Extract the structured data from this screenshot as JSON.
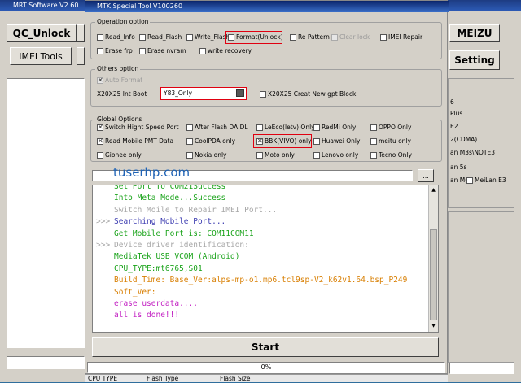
{
  "bg_window": {
    "title": "MRT Software V2.60",
    "qc_unlock": "QC_Unlock",
    "imei_tools": "IMEI Tools",
    "meizu": "MEIZU",
    "setting": "Setting",
    "right_items": [
      "6",
      "Plus",
      "E2",
      "2(CDMA)",
      "an M3s\\NOTE3",
      "an 5s",
      "an M6",
      "MeiLan E3"
    ],
    "table_headers": [
      "CPU TYPE",
      "Flash Type",
      "Flash Size"
    ]
  },
  "dialog": {
    "title": "MTK Special Tool V100260",
    "operation": {
      "legend": "Operation option",
      "items": [
        "Read_Info",
        "Read_Flash",
        "Write_Flash",
        "Format(Unlock)",
        "Re Pattern l",
        "Clear lock",
        "IMEI Repair",
        "Erase frp",
        "Erase nvram",
        "write recovery"
      ]
    },
    "others": {
      "legend": "Others option",
      "auto_format": "Auto Format",
      "int_boot_label": "X20X25 Int Boot",
      "int_boot_value": "Y83_Only",
      "creat_gpt": "X20X25 Creat New gpt Block"
    },
    "global": {
      "legend": "Global Options",
      "items": [
        "Switch Hight Speed Port",
        "After Flash DA DL",
        "LeEco(letv) Only",
        "RedMi Only",
        "OPPO Only",
        "Read Mobile PMT Data",
        "CoolPDA only",
        "BBK(VIVO) only",
        "Huawei Only",
        "meitu only",
        "Gionee only",
        "Nokia only",
        "Moto only",
        "Lenovo only",
        "Tecno Only"
      ]
    },
    "watermark": "tuserhp.com",
    "browse_label": "...",
    "log_lines": [
      {
        "prefix": "",
        "text": "Set Port To COM21Success",
        "color": "#1aa31a"
      },
      {
        "prefix": "",
        "text": "Into Meta Mode...Success",
        "color": "#1aa31a"
      },
      {
        "prefix": "",
        "text": "Switch Moile to Repair IMEI Port...",
        "color": "#a8a8a8"
      },
      {
        "prefix": ">>>",
        "text": "Searching Mobile Port...",
        "color": "#3b3bb0"
      },
      {
        "prefix": "",
        "text": "Get Mobile Port is: COM11COM11",
        "color": "#1aa31a"
      },
      {
        "prefix": ">>>",
        "text": "Device driver identification:",
        "color": "#a8a8a8"
      },
      {
        "prefix": "",
        "text": "MediaTek USB VCOM (Android)",
        "color": "#1aa31a"
      },
      {
        "prefix": "",
        "text": "CPU_TYPE:mt6765,S01",
        "color": "#1aa31a"
      },
      {
        "prefix": "",
        "text": "Build_Time:    Base_Ver:alps-mp-o1.mp6.tcl9sp-V2_k62v1.64.bsp_P249",
        "color": "#d87e00"
      },
      {
        "prefix": "",
        "text": "Soft_Ver:",
        "color": "#d87e00"
      },
      {
        "prefix": "",
        "text": "erase userdata....",
        "color": "#c21fc2"
      },
      {
        "prefix": "",
        "text": "all is done!!!",
        "color": "#c21fc2"
      }
    ],
    "start_label": "Start",
    "progress_text": "0%",
    "progress_value": 0
  }
}
